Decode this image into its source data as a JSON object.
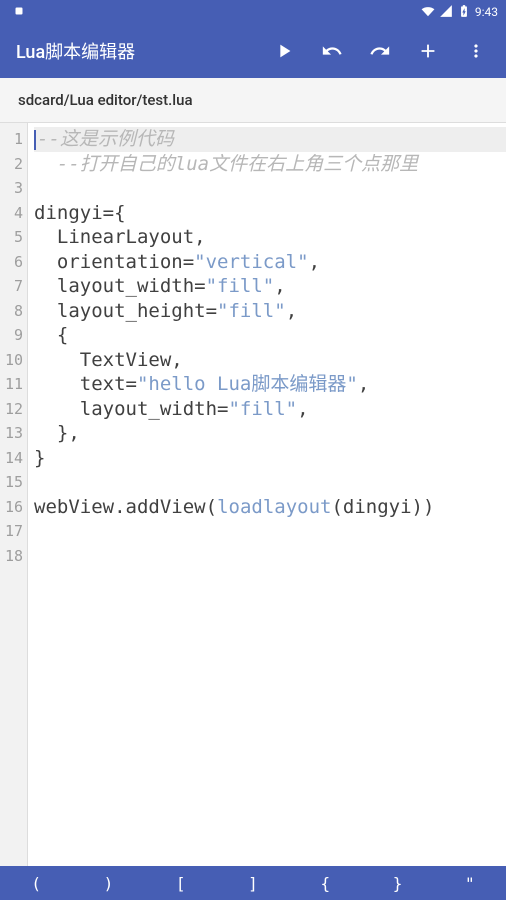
{
  "status": {
    "time": "9:43"
  },
  "toolbar": {
    "title": "Lua脚本编辑器"
  },
  "path": {
    "text": "sdcard/Lua editor/test.lua"
  },
  "code": {
    "lines": [
      {
        "n": 1,
        "hl": true,
        "tokens": [
          {
            "cls": "t-cursor",
            "txt": ""
          },
          {
            "cls": "t-comment",
            "txt": "--这是示例代码"
          }
        ]
      },
      {
        "n": 2,
        "hl": false,
        "tokens": [
          {
            "cls": "t-comment",
            "txt": "  --打开自己的lua文件在右上角三个点那里"
          }
        ]
      },
      {
        "n": 3,
        "hl": false,
        "tokens": []
      },
      {
        "n": 4,
        "hl": false,
        "tokens": [
          {
            "cls": "t-ident",
            "txt": "dingyi"
          },
          {
            "cls": "t-punct",
            "txt": "={"
          }
        ]
      },
      {
        "n": 5,
        "hl": false,
        "tokens": [
          {
            "cls": "t-ident",
            "txt": "  LinearLayout"
          },
          {
            "cls": "t-punct",
            "txt": ","
          }
        ]
      },
      {
        "n": 6,
        "hl": false,
        "tokens": [
          {
            "cls": "t-ident",
            "txt": "  orientation"
          },
          {
            "cls": "t-punct",
            "txt": "="
          },
          {
            "cls": "t-str",
            "txt": "\"vertical\""
          },
          {
            "cls": "t-punct",
            "txt": ","
          }
        ]
      },
      {
        "n": 7,
        "hl": false,
        "tokens": [
          {
            "cls": "t-ident",
            "txt": "  layout_width"
          },
          {
            "cls": "t-punct",
            "txt": "="
          },
          {
            "cls": "t-str",
            "txt": "\"fill\""
          },
          {
            "cls": "t-punct",
            "txt": ","
          }
        ]
      },
      {
        "n": 8,
        "hl": false,
        "tokens": [
          {
            "cls": "t-ident",
            "txt": "  layout_height"
          },
          {
            "cls": "t-punct",
            "txt": "="
          },
          {
            "cls": "t-str",
            "txt": "\"fill\""
          },
          {
            "cls": "t-punct",
            "txt": ","
          }
        ]
      },
      {
        "n": 9,
        "hl": false,
        "tokens": [
          {
            "cls": "t-punct",
            "txt": "  {"
          }
        ]
      },
      {
        "n": 10,
        "hl": false,
        "tokens": [
          {
            "cls": "t-ident",
            "txt": "    TextView"
          },
          {
            "cls": "t-punct",
            "txt": ","
          }
        ]
      },
      {
        "n": 11,
        "hl": false,
        "tokens": [
          {
            "cls": "t-ident",
            "txt": "    text"
          },
          {
            "cls": "t-punct",
            "txt": "="
          },
          {
            "cls": "t-str",
            "txt": "\"hello Lua脚本编辑器\""
          },
          {
            "cls": "t-punct",
            "txt": ","
          }
        ]
      },
      {
        "n": 12,
        "hl": false,
        "tokens": [
          {
            "cls": "t-ident",
            "txt": "    layout_width"
          },
          {
            "cls": "t-punct",
            "txt": "="
          },
          {
            "cls": "t-str",
            "txt": "\"fill\""
          },
          {
            "cls": "t-punct",
            "txt": ","
          }
        ]
      },
      {
        "n": 13,
        "hl": false,
        "tokens": [
          {
            "cls": "t-punct",
            "txt": "  },"
          }
        ]
      },
      {
        "n": 14,
        "hl": false,
        "tokens": [
          {
            "cls": "t-punct",
            "txt": "}"
          }
        ]
      },
      {
        "n": 15,
        "hl": false,
        "tokens": []
      },
      {
        "n": 16,
        "hl": false,
        "tokens": [
          {
            "cls": "t-ident",
            "txt": "webView"
          },
          {
            "cls": "t-punct",
            "txt": "."
          },
          {
            "cls": "t-ident",
            "txt": "addView"
          },
          {
            "cls": "t-punct",
            "txt": "("
          },
          {
            "cls": "t-func",
            "txt": "loadlayout"
          },
          {
            "cls": "t-punct",
            "txt": "("
          },
          {
            "cls": "t-ident",
            "txt": "dingyi"
          },
          {
            "cls": "t-punct",
            "txt": "))"
          }
        ]
      },
      {
        "n": 17,
        "hl": false,
        "tokens": []
      },
      {
        "n": 18,
        "hl": false,
        "tokens": []
      }
    ]
  },
  "bottombar": {
    "keys": [
      "(",
      ")",
      "[",
      "]",
      "{",
      "}",
      "\""
    ]
  },
  "colors": {
    "primary": "#465eb4"
  }
}
